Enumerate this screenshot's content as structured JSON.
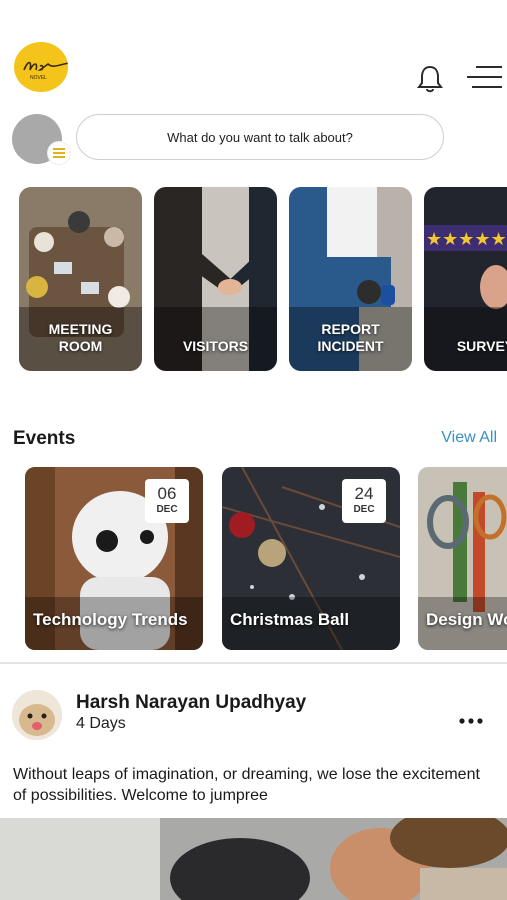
{
  "app": {
    "logo_icon": "brand-logo",
    "notification_icon": "bell-icon",
    "menu_icon": "hamburger-menu-icon"
  },
  "composer": {
    "placeholder": "What do you want to talk about?",
    "avatar_icon": "user-avatar",
    "badge_icon": "list-icon"
  },
  "quick_actions": [
    {
      "label": "MEETING\nROOM",
      "icon": "meeting-room-image"
    },
    {
      "label": "VISITORS",
      "icon": "handshake-image"
    },
    {
      "label": "REPORT\nINCIDENT",
      "icon": "worker-image"
    },
    {
      "label": "SURVEY",
      "icon": "survey-stars-image"
    }
  ],
  "events": {
    "title": "Events",
    "view_all": "View All",
    "items": [
      {
        "title": "Technology Trends",
        "day": "06",
        "month": "DEC"
      },
      {
        "title": "Christmas Ball",
        "day": "24",
        "month": "DEC"
      },
      {
        "title": "Design Wo",
        "day": "",
        "month": ""
      }
    ]
  },
  "post": {
    "author": "Harsh Narayan Upadhyay",
    "time_ago": "4 Days",
    "text": "Without leaps of imagination, or dreaming, we lose the excitement of possibilities. Welcome to jumpree",
    "more_icon": "more-options-icon"
  },
  "colors": {
    "accent": "#3a8fc4",
    "logo_yellow": "#f5c41a",
    "survey_band": "#3d2d72",
    "star": "#f4c82c"
  }
}
